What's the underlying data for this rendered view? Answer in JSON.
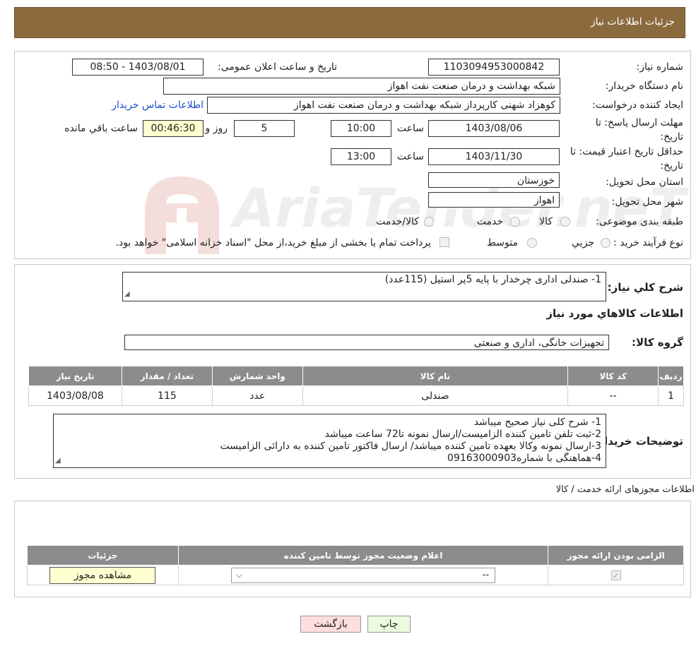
{
  "header": {
    "title": "جزئیات اطلاعات نیاز"
  },
  "need": {
    "need_number_label": "شماره نیاز:",
    "need_number": "1103094953000842",
    "announce_label": "تاریخ و ساعت اعلان عمومی:",
    "announce_value": "1403/08/01 - 08:50",
    "buyer_org_label": "نام دستگاه خریدار:",
    "buyer_org": "شبکه بهداشت و درمان صنعت نفت اهواز",
    "creator_label": "ایجاد کننده درخواست:",
    "creator": "کوهزاد شهنی کارپرداز شبکه بهداشت و درمان صنعت نفت اهواز",
    "contact_link": "اطلاعات تماس خریدار",
    "deadline_label": "مهلت ارسال پاسخ: تا تاریخ:",
    "deadline_date": "1403/08/06",
    "time_label": "ساعت",
    "deadline_time": "10:00",
    "days_value": "5",
    "days_label": "روز و",
    "remaining_time": "00:46:30",
    "remaining_label": "ساعت باقي مانده",
    "validity_label": "حداقل تاریخ اعتبار قیمت: تا تاریخ:",
    "validity_date": "1403/11/30",
    "validity_time": "13:00",
    "province_label": "استان محل تحویل:",
    "province": "خوزستان",
    "city_label": "شهر محل تحویل:",
    "city": "اهواز",
    "category_label": "طبقه بندی موضوعی:",
    "category_options": [
      "کالا",
      "خدمت",
      "کالا/خدمت"
    ],
    "process_label": "نوع فرآیند خرید :",
    "process_options": [
      "جزيي",
      "متوسط"
    ],
    "payment_note": "پرداخت تمام یا بخشی از مبلغ خرید،از محل \"اسناد خزانه اسلامی\" خواهد بود."
  },
  "goods": {
    "summary_label": "شرح كلي نياز:",
    "summary_value": "1- صندلی اداری چرخدار با پایه 5پر استیل (115عدد)",
    "section_title": "اطلاعات كالاهاي مورد نياز",
    "group_label": "گروه كالا:",
    "group_value": "تجهیزات خانگی، اداری و صنعتی",
    "table": {
      "headers": [
        "رديف",
        "كد كالا",
        "نام كالا",
        "واحد شمارش",
        "تعداد / مقدار",
        "تاريخ نياز"
      ],
      "rows": [
        [
          "1",
          "--",
          "صندلی",
          "عدد",
          "115",
          "1403/08/08"
        ]
      ]
    },
    "buyer_notes_label": "توضيحات خريدار:",
    "buyer_notes": [
      "1- شرح کلی نیاز صحیح میباشد",
      "2-ثبت تلفن تامین کننده الزامیست/ارسال نمونه تا72 ساعت میباشد",
      "3-ارسال نمونه وکالا بعهده تامین کننده میباشد/ ارسال فاکتور تامین کننده به دارائی الزامیست",
      "4-هماهنگی با شماره09163000903"
    ]
  },
  "permits": {
    "title": "اطلاعات مجوزهای ارائه خدمت / کالا",
    "headers": [
      "الزامی بودن ارائه مجوز",
      "اعلام وضعیت مجوز توسط تامین کننده",
      "جزئیات"
    ],
    "select_value": "--",
    "view_button": "مشاهده مجوز"
  },
  "footer": {
    "back_button": "بازگشت",
    "print_button": "چاپ"
  },
  "watermark": {
    "text": "AriaTender.neT"
  },
  "colors": {
    "header_bg": "#8b6a3e",
    "table_header": "#8c8c8c",
    "remaining_bg": "#ffffd0",
    "link": "#1a4fd0"
  }
}
